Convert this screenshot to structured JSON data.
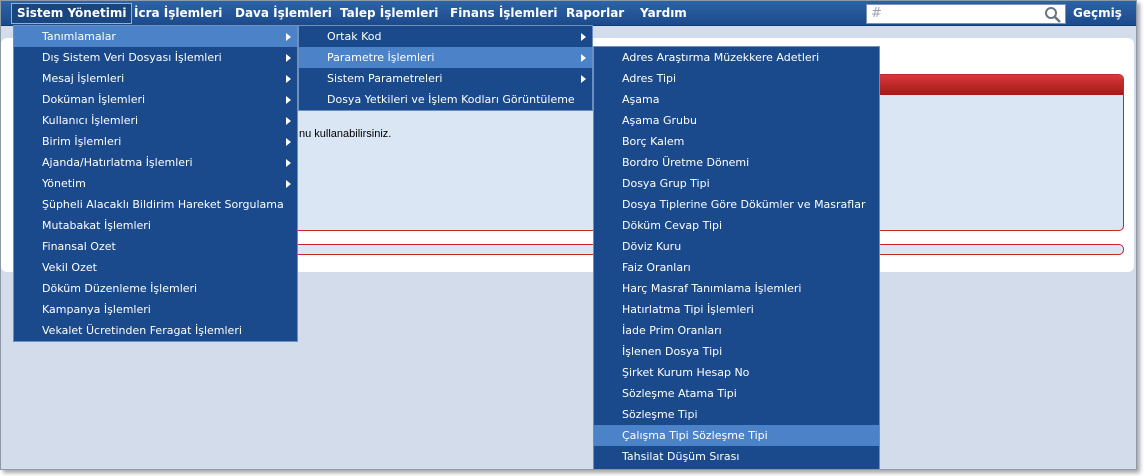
{
  "menubar": {
    "items": [
      {
        "label": "Sistem Yönetimi"
      },
      {
        "label": "İcra İşlemleri"
      },
      {
        "label": "Dava İşlemleri"
      },
      {
        "label": "Talep İşlemleri"
      },
      {
        "label": "Finans İşlemleri"
      },
      {
        "label": "Raporlar"
      },
      {
        "label": "Yardım"
      }
    ],
    "search": {
      "prefix": "#",
      "value": ""
    },
    "history_label": "Geçmiş"
  },
  "page": {
    "text": "nu kullanabilirsiniz."
  },
  "menu1": {
    "items": [
      {
        "label": "Tanımlamalar"
      },
      {
        "label": "Dış Sistem Veri Dosyası İşlemleri"
      },
      {
        "label": "Mesaj İşlemleri"
      },
      {
        "label": "Doküman İşlemleri"
      },
      {
        "label": "Kullanıcı İşlemleri"
      },
      {
        "label": "Birim İşlemleri"
      },
      {
        "label": "Ajanda/Hatırlatma İşlemleri"
      },
      {
        "label": "Yönetim"
      },
      {
        "label": "Şüpheli Alacaklı Bildirim Hareket Sorgulama"
      },
      {
        "label": "Mutabakat İşlemleri"
      },
      {
        "label": "Finansal Ozet"
      },
      {
        "label": "Vekil Ozet"
      },
      {
        "label": "Döküm Düzenleme İşlemleri"
      },
      {
        "label": "Kampanya İşlemleri"
      },
      {
        "label": "Vekalet Ücretinden Feragat İşlemleri"
      }
    ]
  },
  "menu2": {
    "items": [
      {
        "label": "Ortak Kod"
      },
      {
        "label": "Parametre İşlemleri"
      },
      {
        "label": "Sistem Parametreleri"
      },
      {
        "label": "Dosya Yetkileri ve İşlem Kodları Görüntüleme"
      }
    ]
  },
  "menu3": {
    "items": [
      {
        "label": "Adres Araştırma Müzekkere Adetleri"
      },
      {
        "label": "Adres Tipi"
      },
      {
        "label": "Aşama"
      },
      {
        "label": "Aşama Grubu"
      },
      {
        "label": "Borç Kalem"
      },
      {
        "label": "Bordro Üretme Dönemi"
      },
      {
        "label": "Dosya Grup Tipi"
      },
      {
        "label": "Dosya Tiplerine Göre Dökümler ve Masraflar"
      },
      {
        "label": "Döküm Cevap Tipi"
      },
      {
        "label": "Döviz Kuru"
      },
      {
        "label": "Faiz Oranları"
      },
      {
        "label": "Harç Masraf Tanımlama İşlemleri"
      },
      {
        "label": "Hatırlatma Tipi İşlemleri"
      },
      {
        "label": "İade Prim Oranları"
      },
      {
        "label": "İşlenen Dosya Tipi"
      },
      {
        "label": "Şirket Kurum Hesap No"
      },
      {
        "label": "Sözleşme Atama Tipi"
      },
      {
        "label": "Sözleşme Tipi"
      },
      {
        "label": "Çalışma Tipi Sözleşme Tipi"
      },
      {
        "label": "Tahsilat Düşüm Sırası"
      }
    ]
  },
  "colors": {
    "menubar": "#1c4b8c",
    "menu_bg": "#1b4a8c",
    "menu_highlight": "#4b82c8",
    "alert_red": "#c9262c"
  }
}
